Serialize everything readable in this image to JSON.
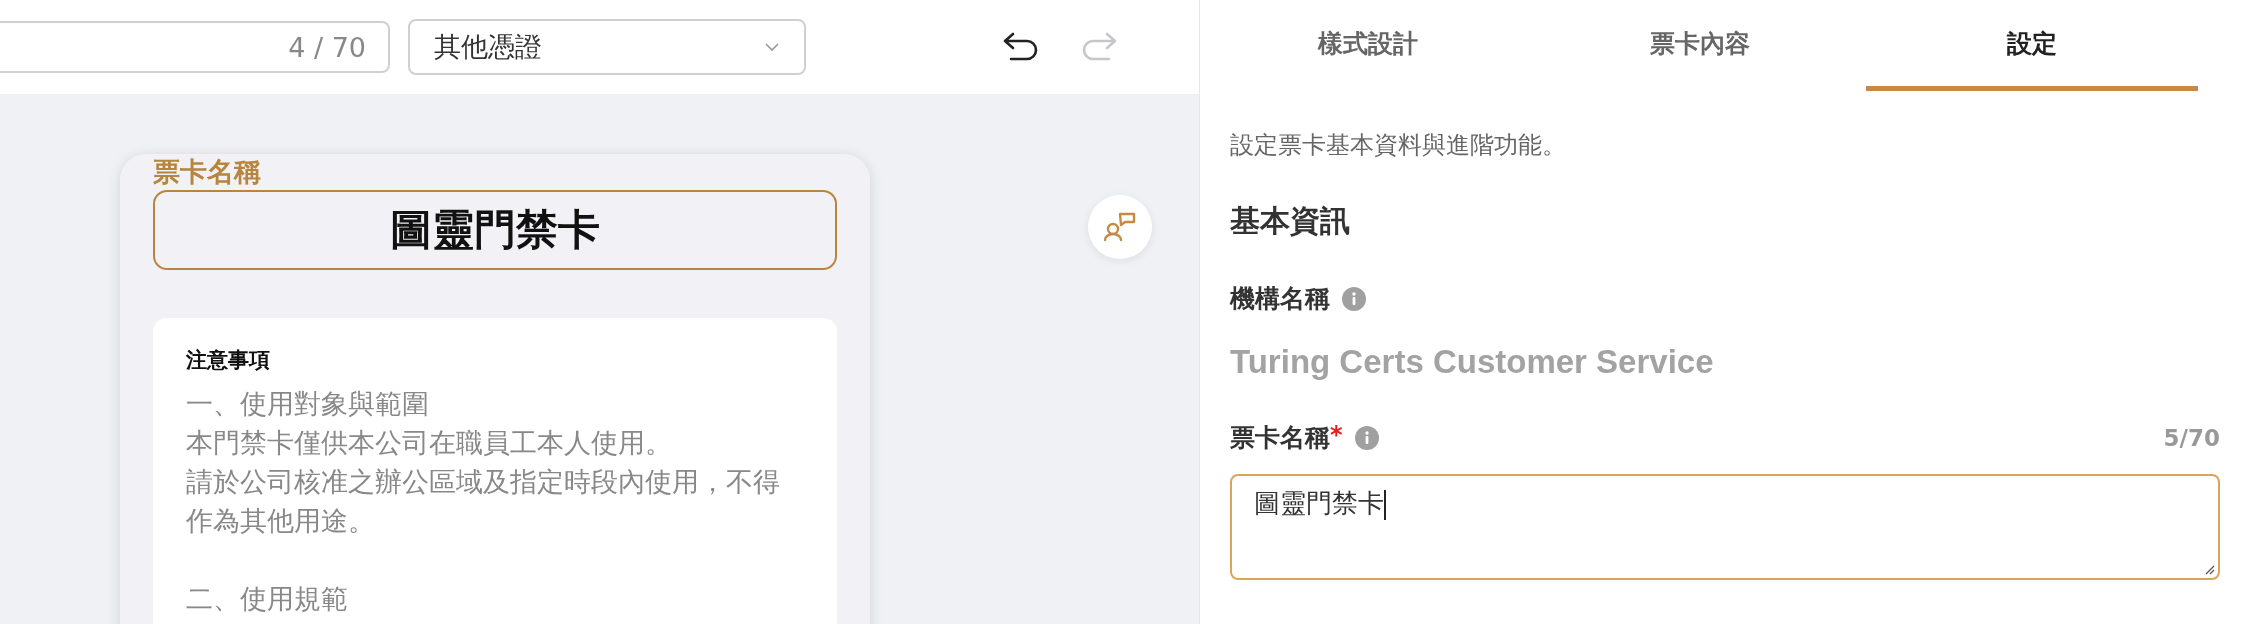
{
  "toolbar": {
    "name_counter": "4 / 70",
    "category_select": {
      "value": "其他憑證"
    },
    "undo": {
      "disabled": false
    },
    "redo": {
      "disabled": true
    }
  },
  "preview": {
    "card_name_label": "票卡名稱",
    "card_title": "圖靈門禁卡",
    "notes": {
      "heading": "注意事項",
      "paragraphs": [
        [
          "一、使用對象與範圍",
          "本門禁卡僅供本公司在職員工本人使用。",
          "請於公司核准之辦公區域及指定時段內使用，不得作為其他用途。"
        ],
        [
          "二、使用規範"
        ]
      ]
    }
  },
  "settings": {
    "tabs": [
      {
        "label": "樣式設計",
        "selected": false
      },
      {
        "label": "票卡內容",
        "selected": false
      },
      {
        "label": "設定",
        "selected": true
      }
    ],
    "description": "設定票卡基本資料與進階功能。",
    "section_title": "基本資訊",
    "fields": [
      {
        "kind": "static",
        "label": "機構名稱",
        "value": "Turing Certs Customer Service"
      },
      {
        "kind": "textarea",
        "label": "票卡名稱",
        "required_mark": "*",
        "counter": "5/70",
        "value": "圖靈門禁卡",
        "focused": true
      }
    ]
  }
}
